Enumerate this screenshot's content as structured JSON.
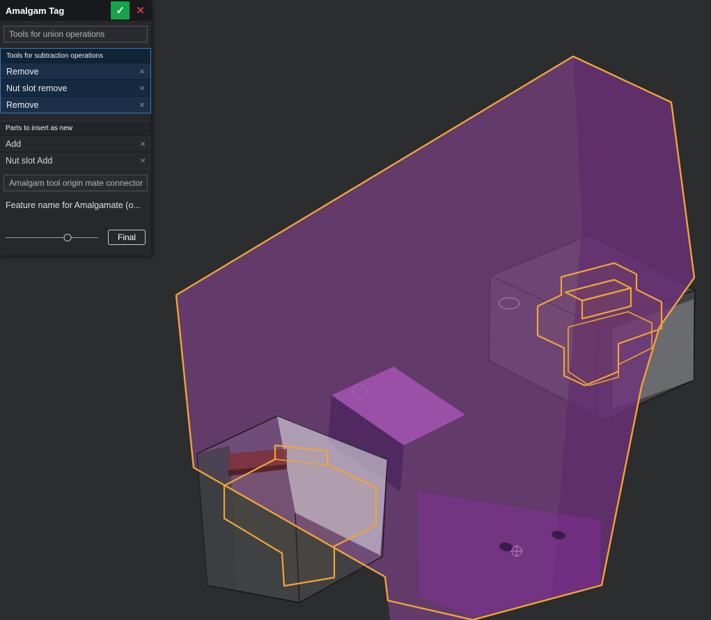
{
  "dialog": {
    "title": "Amalgam Tag",
    "union_field": {
      "placeholder": "Tools for union operations"
    },
    "subtraction_group": {
      "label": "Tools for subtraction operations",
      "items": [
        "Remove",
        "Nut slot remove",
        "Remove"
      ]
    },
    "insert_group": {
      "label": "Parts to insert as new",
      "items": [
        "Add",
        "Nut slot Add"
      ]
    },
    "mate_field": {
      "placeholder": "Amalgam tool origin mate connector"
    },
    "feature_name_field": {
      "value": "Feature name for Amalgamate (o..."
    },
    "footer": {
      "final_label": "Final",
      "slider_pct": 67
    }
  },
  "icons": {
    "check": "✓",
    "close": "✕",
    "remove": "×"
  },
  "colors": {
    "accept_green": "#16a34a",
    "cancel_red": "#d23b33",
    "selection_blue": "#3a7abd",
    "edge_orange": "#f3a433",
    "body_purple": "#9a4aa8",
    "viewport_bg": "#2b2d2f"
  }
}
